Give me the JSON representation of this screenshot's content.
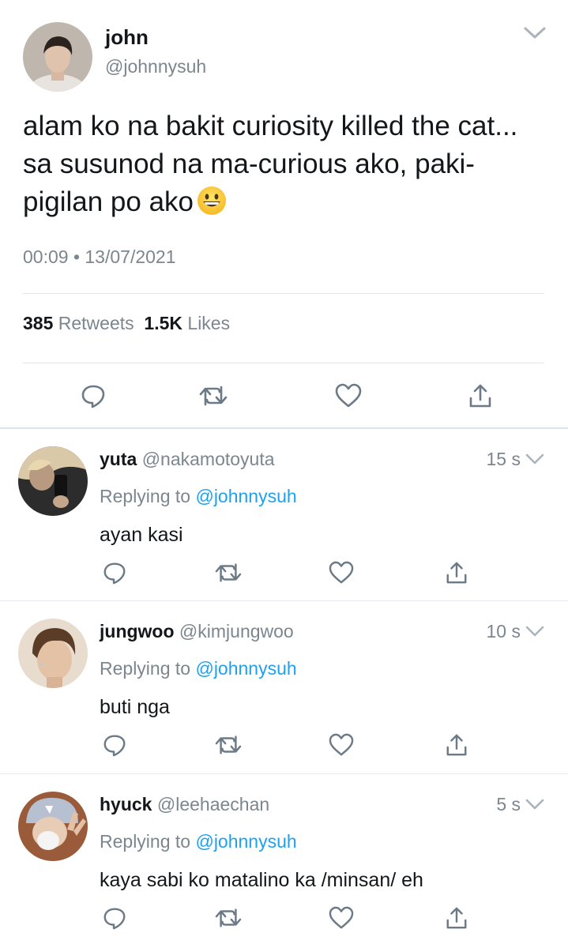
{
  "main_tweet": {
    "name": "john",
    "handle": "@johnnysuh",
    "text": "alam ko na bakit curiosity killed the cat... sa susunod na ma-curious ako, paki-pigilan po ako",
    "emoji": "grinning-face",
    "timestamp": "00:09 • 13/07/2021",
    "retweets_count": "385",
    "retweets_label": "Retweets",
    "likes_count": "1.5K",
    "likes_label": "Likes"
  },
  "replies": [
    {
      "name": "yuta",
      "handle": "@nakamotoyuta",
      "time": "15 s",
      "replying_prefix": "Replying to",
      "replying_to": "@johnnysuh",
      "text": "ayan kasi"
    },
    {
      "name": "jungwoo",
      "handle": "@kimjungwoo",
      "time": "10 s",
      "replying_prefix": "Replying to",
      "replying_to": "@johnnysuh",
      "text": "buti nga"
    },
    {
      "name": "hyuck",
      "handle": "@leehaechan",
      "time": "5 s",
      "replying_prefix": "Replying to",
      "replying_to": "@johnnysuh",
      "text": "kaya sabi ko matalino ka /minsan/ eh"
    }
  ],
  "icons": [
    "reply-icon",
    "retweet-icon",
    "like-icon",
    "share-icon",
    "chevron-down-icon"
  ],
  "colors": {
    "text": "#14171a",
    "secondary": "#7b868f",
    "mention": "#1da1f2",
    "divider": "#e1e6ea"
  }
}
